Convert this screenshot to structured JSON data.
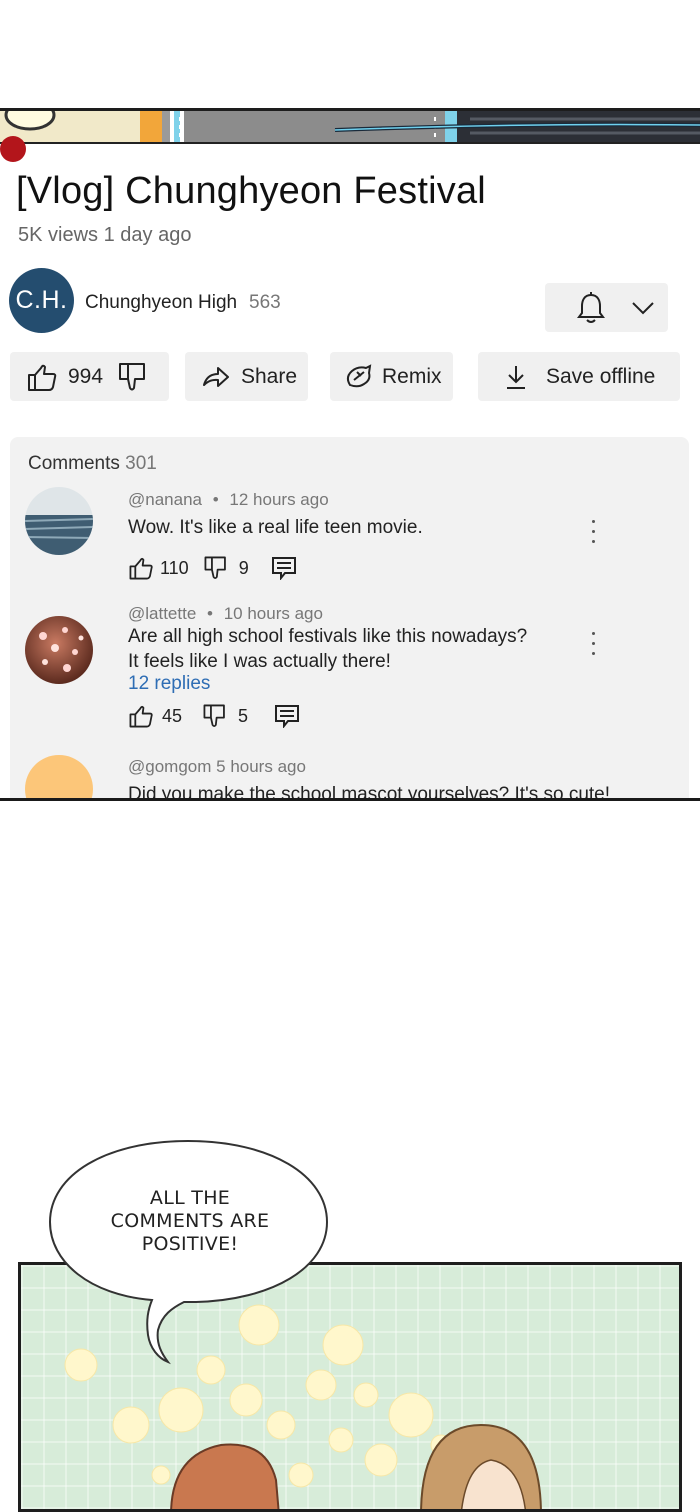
{
  "video": {
    "title": "[Vlog] Chunghyeon Festival",
    "views": "5K views",
    "age": "1 day ago"
  },
  "channel": {
    "initials": "C.H.",
    "name": "Chunghyeon High",
    "subscribers": "563",
    "avatar_color": "#244d6f"
  },
  "actions": {
    "likes": "994",
    "share": "Share",
    "remix": "Remix",
    "save_offline": "Save offline"
  },
  "comments": {
    "label": "Comments",
    "count": "301",
    "items": [
      {
        "handle": "@nanana",
        "time": "12 hours ago",
        "lines": [
          "Wow. It's like a real life teen movie."
        ],
        "likes": "110",
        "dislikes": "9",
        "replies": ""
      },
      {
        "handle": "@lattette",
        "time": "10 hours ago",
        "lines": [
          "Are all high school festivals like this nowadays?",
          "It feels like I was actually there!"
        ],
        "likes": "45",
        "dislikes": "5",
        "replies": "12 replies"
      },
      {
        "handle": "@gomgom",
        "time": "5 hours ago",
        "lines": [
          "Did you make the school mascot yourselves? It's so cute!"
        ],
        "likes": "",
        "dislikes": "",
        "replies": ""
      }
    ]
  },
  "speech_bubble": {
    "lines": [
      "ALL THE",
      "COMMENTS ARE",
      "POSITIVE!"
    ]
  },
  "colors": {
    "progress": "#b3151b",
    "link": "#2e6db4",
    "panel_bg": "#d7ecd9"
  }
}
